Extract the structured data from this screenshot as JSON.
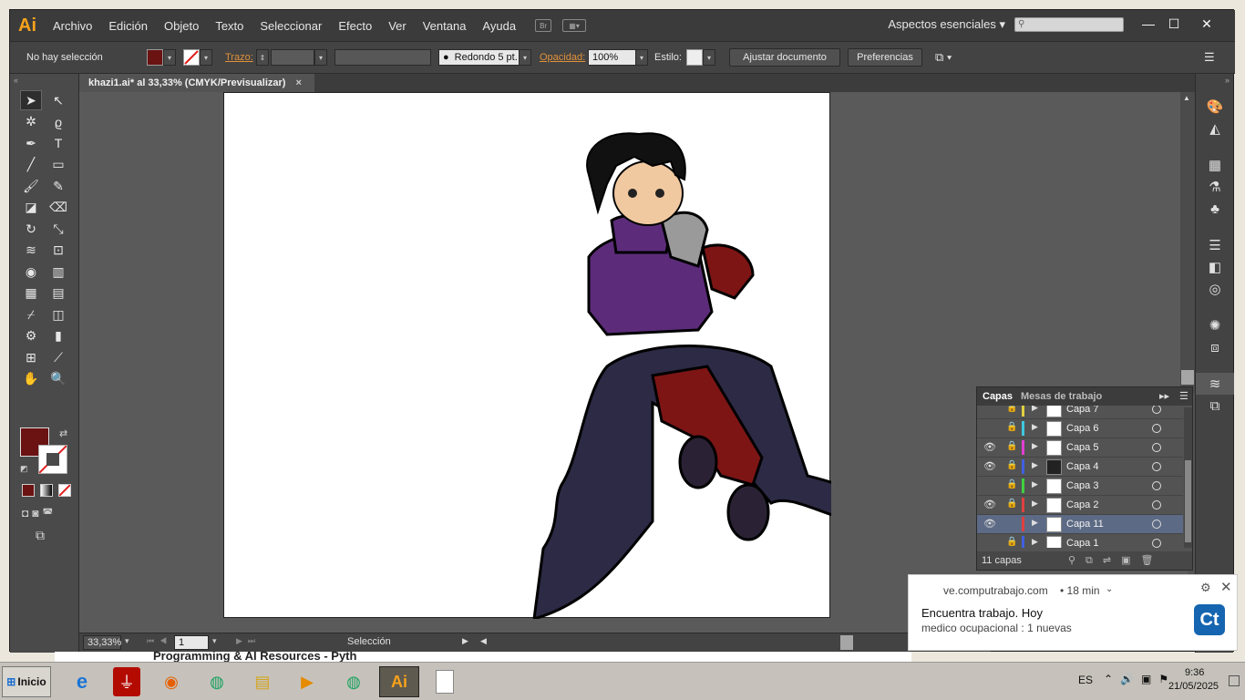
{
  "app": {
    "logo": "Ai",
    "menu": [
      "Archivo",
      "Edición",
      "Objeto",
      "Texto",
      "Seleccionar",
      "Efecto",
      "Ver",
      "Ventana",
      "Ayuda"
    ],
    "bridge_label": "Br",
    "workspace": "Aspectos esenciales",
    "window_controls": [
      "—",
      "☐",
      "✕"
    ]
  },
  "controlbar": {
    "selection": "No hay selección",
    "stroke_label": "Trazo:",
    "brush": "Redondo 5 pt.",
    "opacity_label": "Opacidad:",
    "opacity_value": "100%",
    "style_label": "Estilo:",
    "fit_doc": "Ajustar documento",
    "prefs": "Preferencias",
    "fill_color": "#6b1212"
  },
  "document": {
    "tab_title": "khazi1.ai* al 33,33% (CMYK/Previsualizar)",
    "close": "×"
  },
  "statusbar": {
    "zoom": "33,33%",
    "page": "1",
    "tool": "Selección"
  },
  "layers_panel": {
    "tabs": [
      "Capas",
      "Mesas de trabajo"
    ],
    "count": "11 capas",
    "rows": [
      {
        "name": "Capa 7",
        "visible": false,
        "color": "#e0d040"
      },
      {
        "name": "Capa 6",
        "visible": false,
        "color": "#40c8e0"
      },
      {
        "name": "Capa 5",
        "visible": true,
        "color": "#e040d0"
      },
      {
        "name": "Capa 4",
        "visible": true,
        "color": "#4060e0"
      },
      {
        "name": "Capa 3",
        "visible": false,
        "color": "#40d040"
      },
      {
        "name": "Capa 2",
        "visible": true,
        "color": "#e04040"
      },
      {
        "name": "Capa 11",
        "visible": true,
        "color": "#e04040",
        "selected": true
      },
      {
        "name": "Capa 1",
        "visible": false,
        "color": "#4060e0"
      }
    ]
  },
  "notification": {
    "source": "ve.computrabajo.com",
    "time": "• 18 min",
    "title": "Encuentra trabajo. Hoy",
    "body": "medico ocupacional : 1 nuevas",
    "badge": "Ct"
  },
  "browser_strip_text": "Programming & AI Resources - Pyth",
  "taskbar": {
    "start": "Inicio",
    "lang": "ES",
    "time": "9:36",
    "date": "21/05/2025"
  }
}
